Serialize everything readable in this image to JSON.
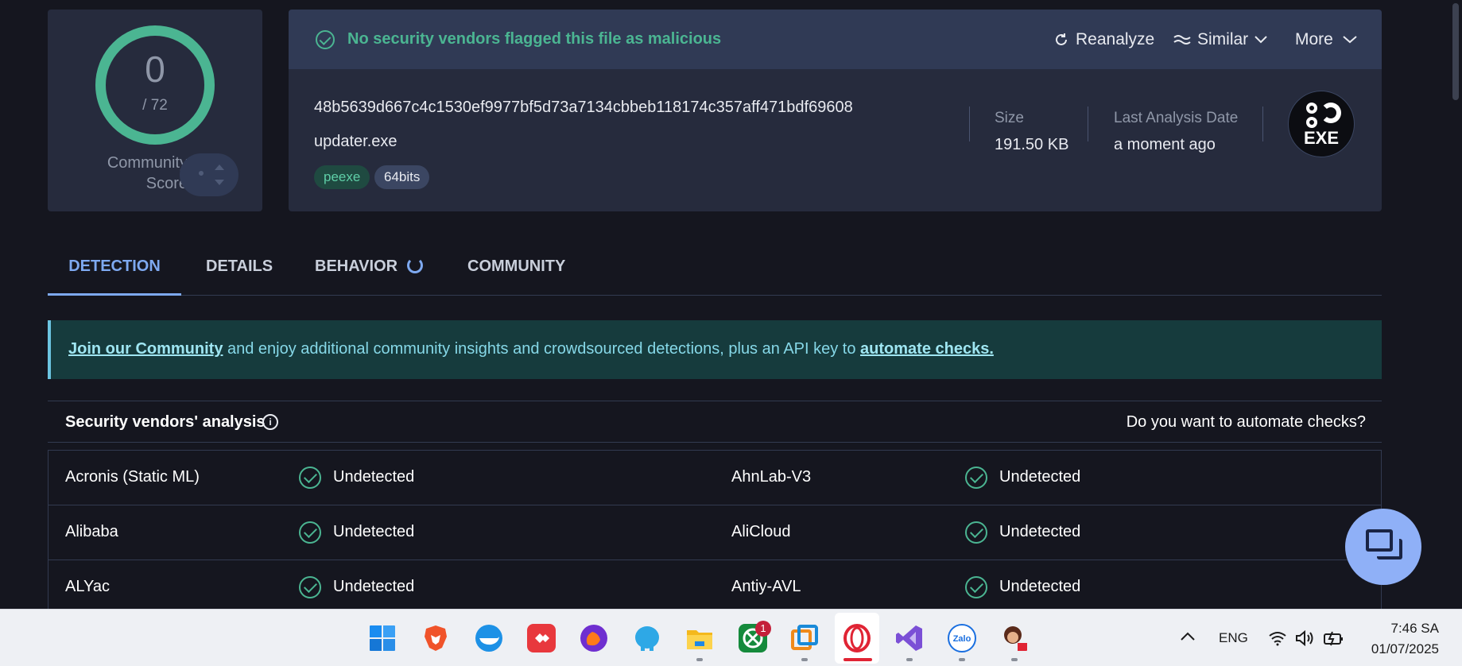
{
  "score": {
    "detections": "0",
    "total": "/ 72",
    "community_label": "Community Score"
  },
  "status": {
    "text": "No security vendors flagged this file as malicious",
    "color": "#4bb592"
  },
  "toolbar": {
    "reanalyze": "Reanalyze",
    "similar": "Similar",
    "more": "More"
  },
  "file": {
    "hash": "48b5639d667c4c1530ef9977bf5d73a7134cbbeb118174c357aff471bdf69608",
    "name": "updater.exe",
    "tags": [
      "peexe",
      "64bits"
    ],
    "size_label": "Size",
    "size_value": "191.50 KB",
    "date_label": "Last Analysis Date",
    "date_value": "a moment ago",
    "type_icon_label": "EXE"
  },
  "tabs": [
    {
      "label": "DETECTION",
      "active": true
    },
    {
      "label": "DETAILS",
      "active": false
    },
    {
      "label": "BEHAVIOR",
      "active": false
    },
    {
      "label": "COMMUNITY",
      "active": false
    }
  ],
  "banner": {
    "link1": "Join our Community",
    "middle": " and enjoy additional community insights and crowdsourced detections, plus an API key to ",
    "link2": "automate checks."
  },
  "vendors": {
    "title": "Security vendors' analysis",
    "automate": "Do you want to automate checks?",
    "rows": [
      [
        {
          "name": "Acronis (Static ML)",
          "result": "Undetected"
        },
        {
          "name": "AhnLab-V3",
          "result": "Undetected"
        }
      ],
      [
        {
          "name": "Alibaba",
          "result": "Undetected"
        },
        {
          "name": "AliCloud",
          "result": "Undetected"
        }
      ],
      [
        {
          "name": "ALYac",
          "result": "Undetected"
        },
        {
          "name": "Antiy-AVL",
          "result": "Undetected"
        }
      ]
    ]
  },
  "taskbar": {
    "apps": [
      "windows-start",
      "brave",
      "docker",
      "anydesk",
      "firefox-dev",
      "postgres-elephant",
      "file-explorer",
      "xbox",
      "vmware",
      "opera",
      "visual-studio",
      "zalo",
      "avatar-app"
    ],
    "xbox_badge": "1",
    "language": "ENG",
    "time": "7:46 SA",
    "date": "01/07/2025"
  }
}
